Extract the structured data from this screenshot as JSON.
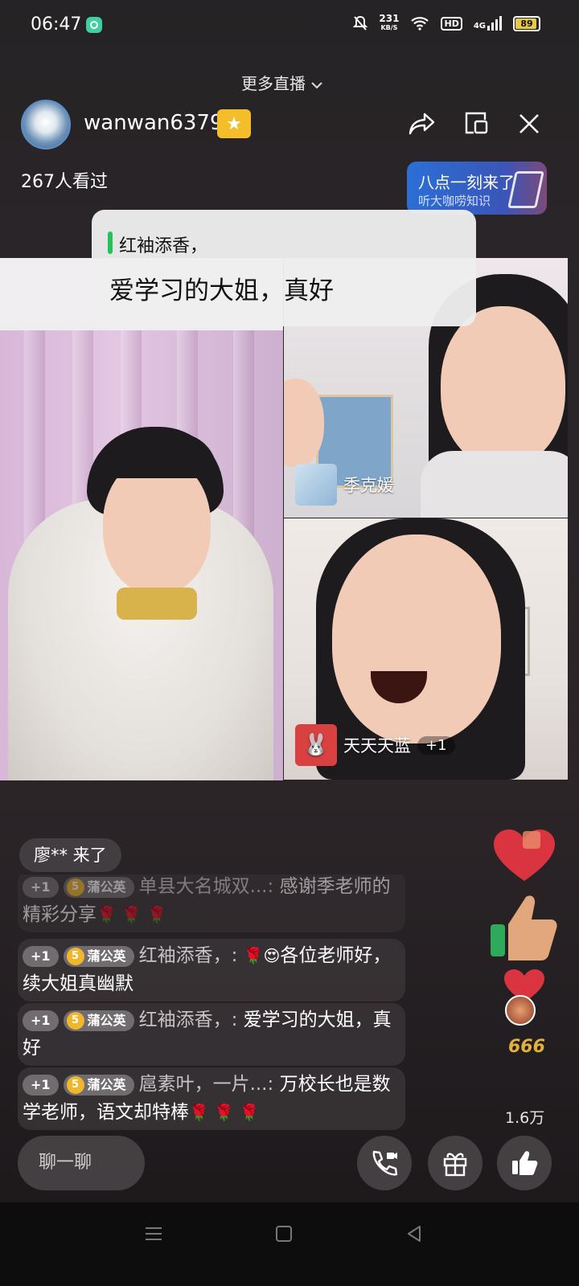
{
  "status_bar": {
    "time": "06:47",
    "speed_value": "231",
    "speed_unit": "KB/S",
    "hd": "HD",
    "network": "4G",
    "battery": "89"
  },
  "header": {
    "more_live": "更多直播",
    "username": "wanwan6379",
    "viewers": "267人看过"
  },
  "promo": {
    "title": "八点一刻来了",
    "subtitle": "听大咖唠知识"
  },
  "popup": {
    "author": "红袖添香，",
    "message": "爱学习的大姐，真好"
  },
  "tiles": {
    "r1_name": "季克媛",
    "r2_name": "天天天蓝",
    "r2_plus": "+1"
  },
  "chat": {
    "join_notice": "廖** 来了",
    "fan_label": "蒲公英",
    "messages": [
      {
        "plus": "+1",
        "nick": "单县大名城双...:",
        "text": "感谢季老师的精彩分享",
        "emoji": "🌹 🌹 🌹"
      },
      {
        "plus": "+1",
        "nick": "红袖添香，:",
        "emoji": "🌹😍",
        "text": "各位老师好，续大姐真幽默"
      },
      {
        "plus": "+1",
        "nick": "红袖添香，:",
        "text": "爱学习的大姐，真好"
      },
      {
        "plus": "+1",
        "nick": "扈素叶，一片...:",
        "text": "万校长也是数学老师，语文却特棒",
        "emoji": "🌹 🌹 🌹"
      }
    ]
  },
  "effects": {
    "six": "666",
    "likes": "1.6万"
  },
  "bottom": {
    "chat_placeholder": "聊一聊"
  },
  "colors": {
    "badge": "#f4be2a",
    "popup_bar": "#23c25a",
    "promo": "#2b6fd6"
  }
}
